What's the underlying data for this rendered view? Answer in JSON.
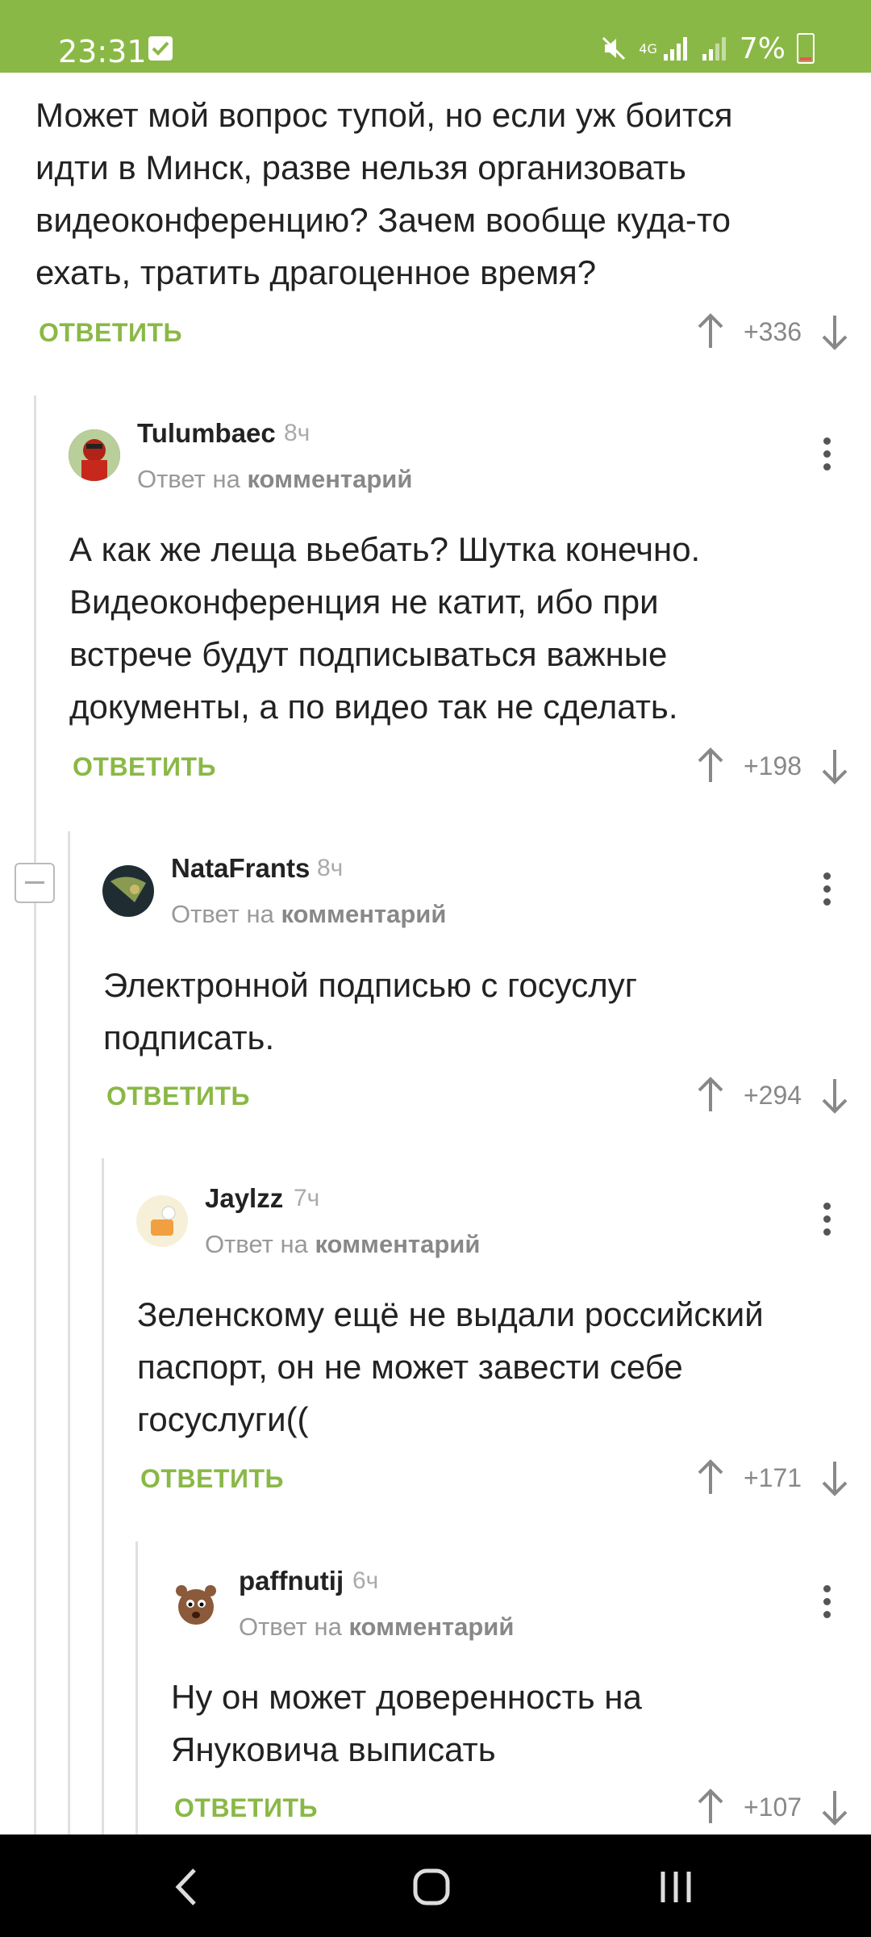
{
  "status": {
    "time": "23:31",
    "battery": "7%",
    "network": "4G"
  },
  "colors": {
    "accent": "#8ab846",
    "text": "#222222",
    "muted": "#999999"
  },
  "comments": [
    {
      "text_lines": [
        "Может мой вопрос тупой, но если уж боится",
        "идти в Минск, разве нельзя организовать",
        "видеоконференцию? Зачем вообще куда-то",
        "ехать, тратить драгоценное время?"
      ],
      "reply_label": "ОТВЕТИТЬ",
      "rating": "+336"
    },
    {
      "user": "Tulumbaec",
      "age": "8ч",
      "replyto_prefix": "Ответ на",
      "replyto_link": "комментарий",
      "text_lines": [
        "А как же леща вьебать? Шутка конечно.",
        "Видеоконференция не катит, ибо при",
        "встрече будут подписываться важные",
        "документы, а по видео так не сделать."
      ],
      "reply_label": "ОТВЕТИТЬ",
      "rating": "+198"
    },
    {
      "user": "NataFrants",
      "age": "8ч",
      "replyto_prefix": "Ответ на",
      "replyto_link": "комментарий",
      "text_lines": [
        "Электронной подписью с госуслуг",
        "подписать."
      ],
      "reply_label": "ОТВЕТИТЬ",
      "rating": "+294"
    },
    {
      "user": "Jaylzz",
      "age": "7ч",
      "replyto_prefix": "Ответ на",
      "replyto_link": "комментарий",
      "text_lines": [
        "Зеленскому ещё не выдали российский",
        "паспорт, он не может завести себе",
        "госуслуги(("
      ],
      "reply_label": "ОТВЕТИТЬ",
      "rating": "+171"
    },
    {
      "user": "paffnutij",
      "age": "6ч",
      "replyto_prefix": "Ответ на",
      "replyto_link": "комментарий",
      "text_lines": [
        "Ну он может доверенность на",
        "Януковича выписать"
      ],
      "reply_label": "ОТВЕТИТЬ",
      "rating": "+107"
    }
  ],
  "icons": {
    "upvote": "arrow-up-icon",
    "downvote": "arrow-down-icon",
    "menu": "more-vertical-icon",
    "collapse": "collapse-minus-icon",
    "nav_back": "back-icon",
    "nav_home": "home-icon",
    "nav_recents": "recents-icon"
  }
}
